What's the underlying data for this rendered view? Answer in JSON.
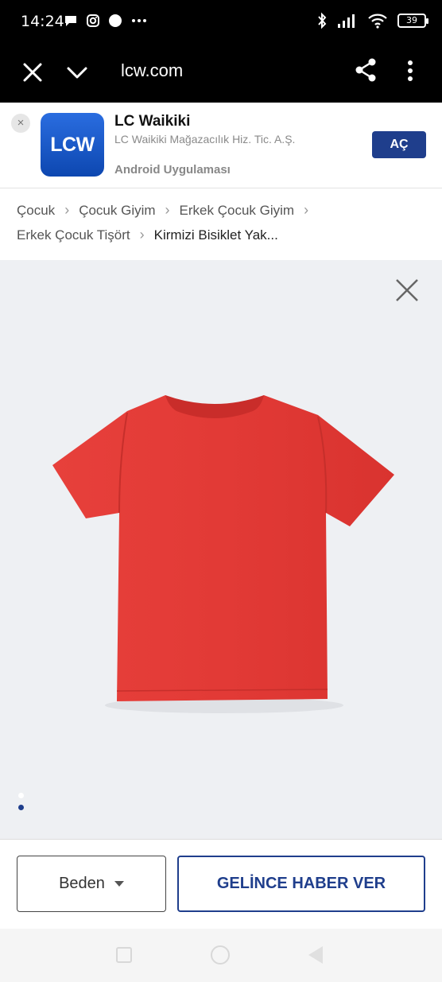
{
  "status_bar": {
    "time": "14:24",
    "battery": "39"
  },
  "toolbar": {
    "url": "lcw.com"
  },
  "app_banner": {
    "logo_text": "LCW",
    "app_name": "LC Waikiki",
    "publisher": "LC Waikiki Mağazacılık Hiz. Tic. A.Ş.",
    "platform": "Android Uygulaması",
    "open_label": "AÇ",
    "close_label": "×"
  },
  "breadcrumb": {
    "items": [
      "Çocuk",
      "Çocuk Giyim",
      "Erkek Çocuk Giyim",
      "Erkek Çocuk Tişört",
      "Kirmizi Bisiklet Yak..."
    ]
  },
  "gallery": {
    "slide_count": 2,
    "active_slide": 2,
    "product_color": "#e23a36"
  },
  "actions": {
    "size_label": "Beden",
    "notify_label": "GELİNCE HABER VER"
  },
  "colors": {
    "brand_blue": "#1f3e8c",
    "toolbar_bg": "#000000"
  }
}
